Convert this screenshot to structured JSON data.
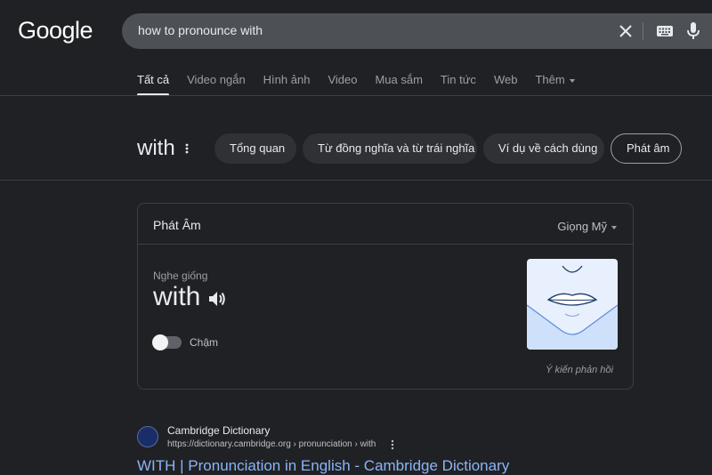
{
  "logo": "Google",
  "search": {
    "query": "how to pronounce with"
  },
  "tabs": [
    {
      "label": "Tất cả"
    },
    {
      "label": "Video ngắn"
    },
    {
      "label": "Hình ảnh"
    },
    {
      "label": "Video"
    },
    {
      "label": "Mua sắm"
    },
    {
      "label": "Tin tức"
    },
    {
      "label": "Web"
    },
    {
      "label": "Thêm"
    }
  ],
  "term": "with",
  "chips": [
    {
      "label": "Tổng quan"
    },
    {
      "label": "Từ đồng nghĩa và từ trái nghĩa"
    },
    {
      "label": "Ví dụ về cách dùng"
    },
    {
      "label": "Phát âm"
    }
  ],
  "card": {
    "title": "Phát Âm",
    "accent": "Giọng Mỹ",
    "sounds_like": "Nghe giống",
    "word": "with",
    "slow_label": "Chậm",
    "feedback": "Ý kiến phản hồi"
  },
  "result": {
    "site": "Cambridge Dictionary",
    "url": "https://dictionary.cambridge.org › pronunciation › with",
    "title": "WITH | Pronunciation in English - Cambridge Dictionary"
  },
  "icons": [
    "close-icon",
    "keyboard-icon",
    "mic-icon",
    "kebab-icon",
    "speaker-icon",
    "mouth-illustration",
    "favicon"
  ],
  "colors": {
    "bg": "#202124",
    "link": "#8ab4f8",
    "search_bg": "#4d5156"
  }
}
